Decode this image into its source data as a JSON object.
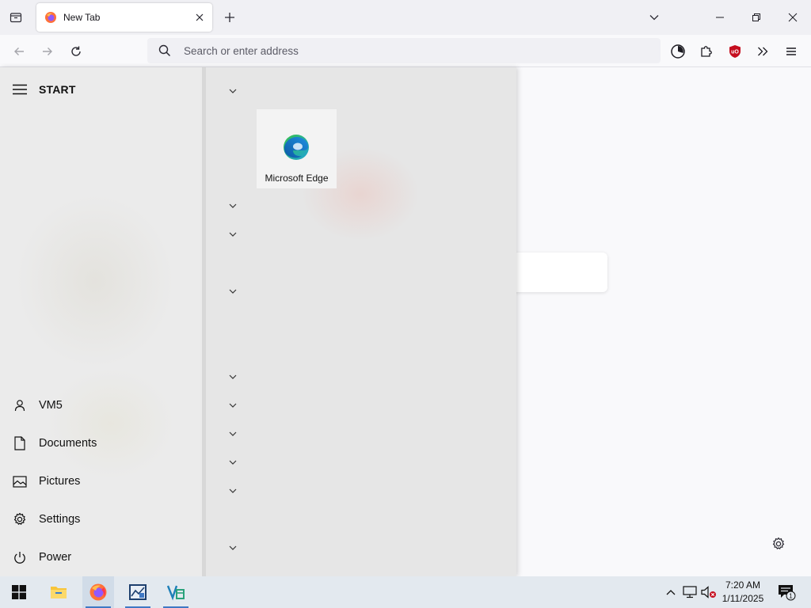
{
  "browser": {
    "tab": {
      "title": "New Tab"
    },
    "urlbar": {
      "placeholder": "Search or enter address",
      "value": ""
    }
  },
  "start_menu": {
    "header_label": "START",
    "side_items": [
      {
        "label": "VM5",
        "icon": "user-icon"
      },
      {
        "label": "Documents",
        "icon": "document-icon"
      },
      {
        "label": "Pictures",
        "icon": "pictures-icon"
      },
      {
        "label": "Settings",
        "icon": "settings-icon"
      },
      {
        "label": "Power",
        "icon": "power-icon"
      }
    ],
    "tiles": [
      {
        "label": "Microsoft Edge",
        "icon": "edge-icon"
      }
    ]
  },
  "taskbar": {
    "apps": [
      {
        "name": "start",
        "icon": "windows-logo-icon"
      },
      {
        "name": "file-explorer",
        "icon": "folder-icon"
      },
      {
        "name": "firefox",
        "icon": "firefox-icon",
        "active": true
      },
      {
        "name": "app-3",
        "icon": "chart-app-icon"
      },
      {
        "name": "app-4",
        "icon": "vs-app-icon"
      }
    ],
    "clock": {
      "time": "7:20 AM",
      "date": "1/11/2025"
    },
    "notification_count": "1"
  },
  "colors": {
    "accent": "#3f78c4",
    "ublock_red": "#c50e1f",
    "firefox_orange": "#ff7139",
    "edge_blue": "#0c59a4",
    "edge_green": "#35c04d"
  }
}
